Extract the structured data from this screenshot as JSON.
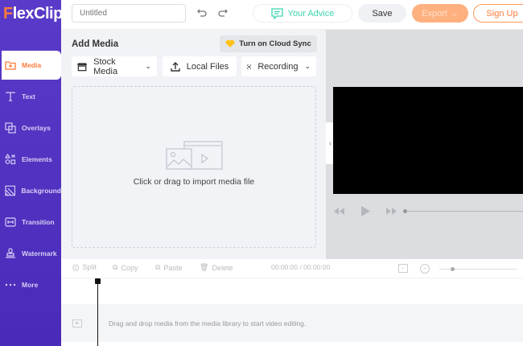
{
  "app": {
    "logo": "FlexClip",
    "logo_first": "F",
    "logo_rest": "lexClip"
  },
  "topbar": {
    "title_placeholder": "Untitled",
    "advice": "Your Advice",
    "save": "Save",
    "export": "Export →",
    "signup": "Sign Up"
  },
  "sidebar": {
    "items": [
      {
        "label": "Media",
        "icon": "folder-plus-icon"
      },
      {
        "label": "Text",
        "icon": "text-icon"
      },
      {
        "label": "Overlays",
        "icon": "overlays-icon"
      },
      {
        "label": "Elements",
        "icon": "elements-icon"
      },
      {
        "label": "Background",
        "icon": "background-icon"
      },
      {
        "label": "Transition",
        "icon": "transition-icon"
      },
      {
        "label": "Watermark",
        "icon": "watermark-icon"
      },
      {
        "label": "More",
        "icon": "more-icon"
      }
    ]
  },
  "panel": {
    "title": "Add Media",
    "cloud_sync": "Turn on Cloud Sync",
    "stock_media": "Stock Media",
    "local_files": "Local Files",
    "recording": "Recording",
    "drop_text": "Click or drag to import media file"
  },
  "timeline": {
    "split": "Split",
    "copy": "Copy",
    "paste": "Paste",
    "delete": "Delete",
    "time": "00:00:00 / 00:00:00",
    "empty_text": "Drag and drop media from the media library to start video editing."
  },
  "colors": {
    "sidebar": "#5536c4",
    "accent": "#ff7b3a",
    "advice": "#3dd6b0"
  }
}
